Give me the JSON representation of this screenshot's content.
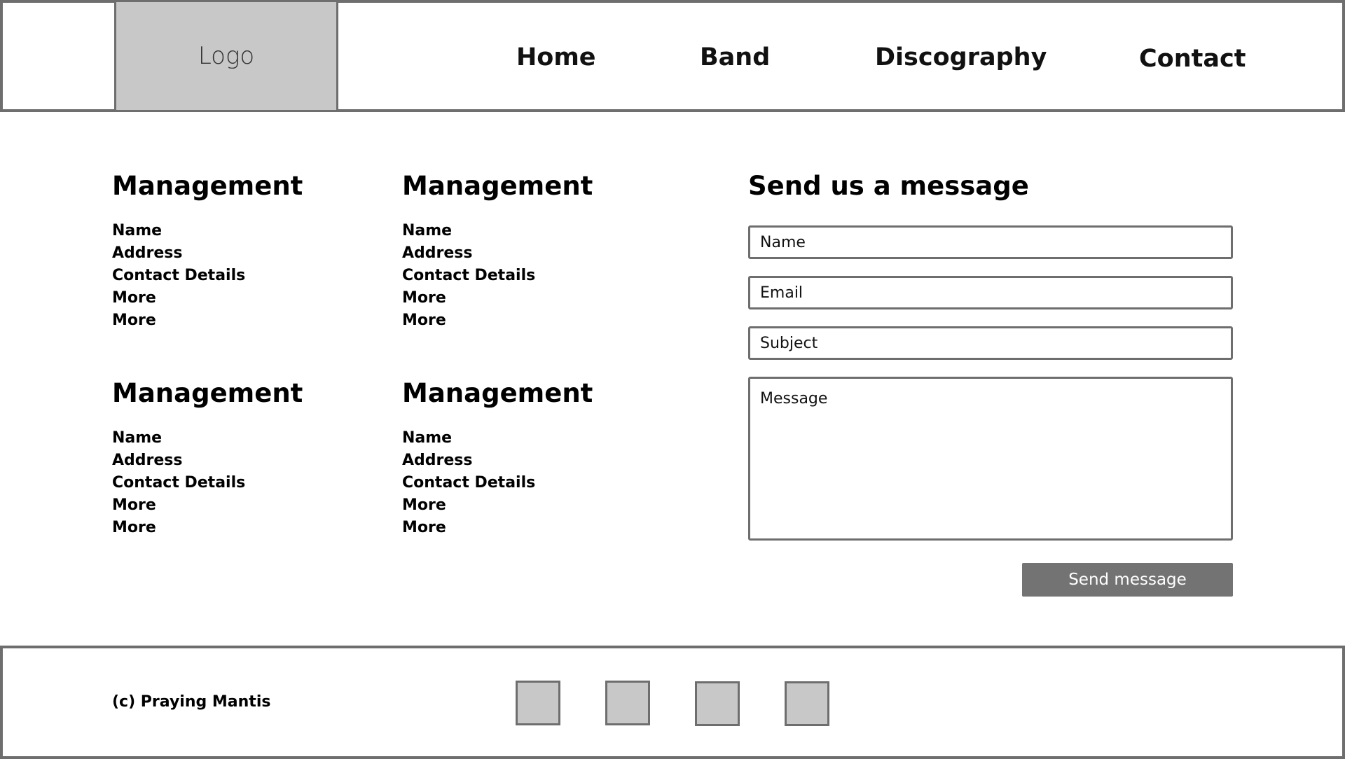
{
  "header": {
    "logo": "Logo",
    "nav": [
      "Home",
      "Band",
      "Discography",
      "Contact"
    ]
  },
  "management": [
    {
      "title": "Management",
      "items": [
        "Name",
        "Address",
        "Contact Details",
        "More",
        "More"
      ]
    },
    {
      "title": "Management",
      "items": [
        "Name",
        "Address",
        "Contact Details",
        "More",
        "More"
      ]
    },
    {
      "title": "Management",
      "items": [
        "Name",
        "Address",
        "Contact Details",
        "More",
        "More"
      ]
    },
    {
      "title": "Management",
      "items": [
        "Name",
        "Address",
        "Contact Details",
        "More",
        "More"
      ]
    }
  ],
  "form": {
    "title": "Send us a message",
    "name_placeholder": "Name",
    "email_placeholder": "Email",
    "subject_placeholder": "Subject",
    "message_placeholder": "Message",
    "submit_label": "Send message"
  },
  "footer": {
    "copyright": "(c) Praying Mantis",
    "social_icons": [
      "social-icon-1",
      "social-icon-2",
      "social-icon-3",
      "social-icon-4"
    ]
  },
  "colors": {
    "border": "#6e6e6e",
    "placeholder_fill": "#c8c8c8",
    "button": "#737373"
  }
}
